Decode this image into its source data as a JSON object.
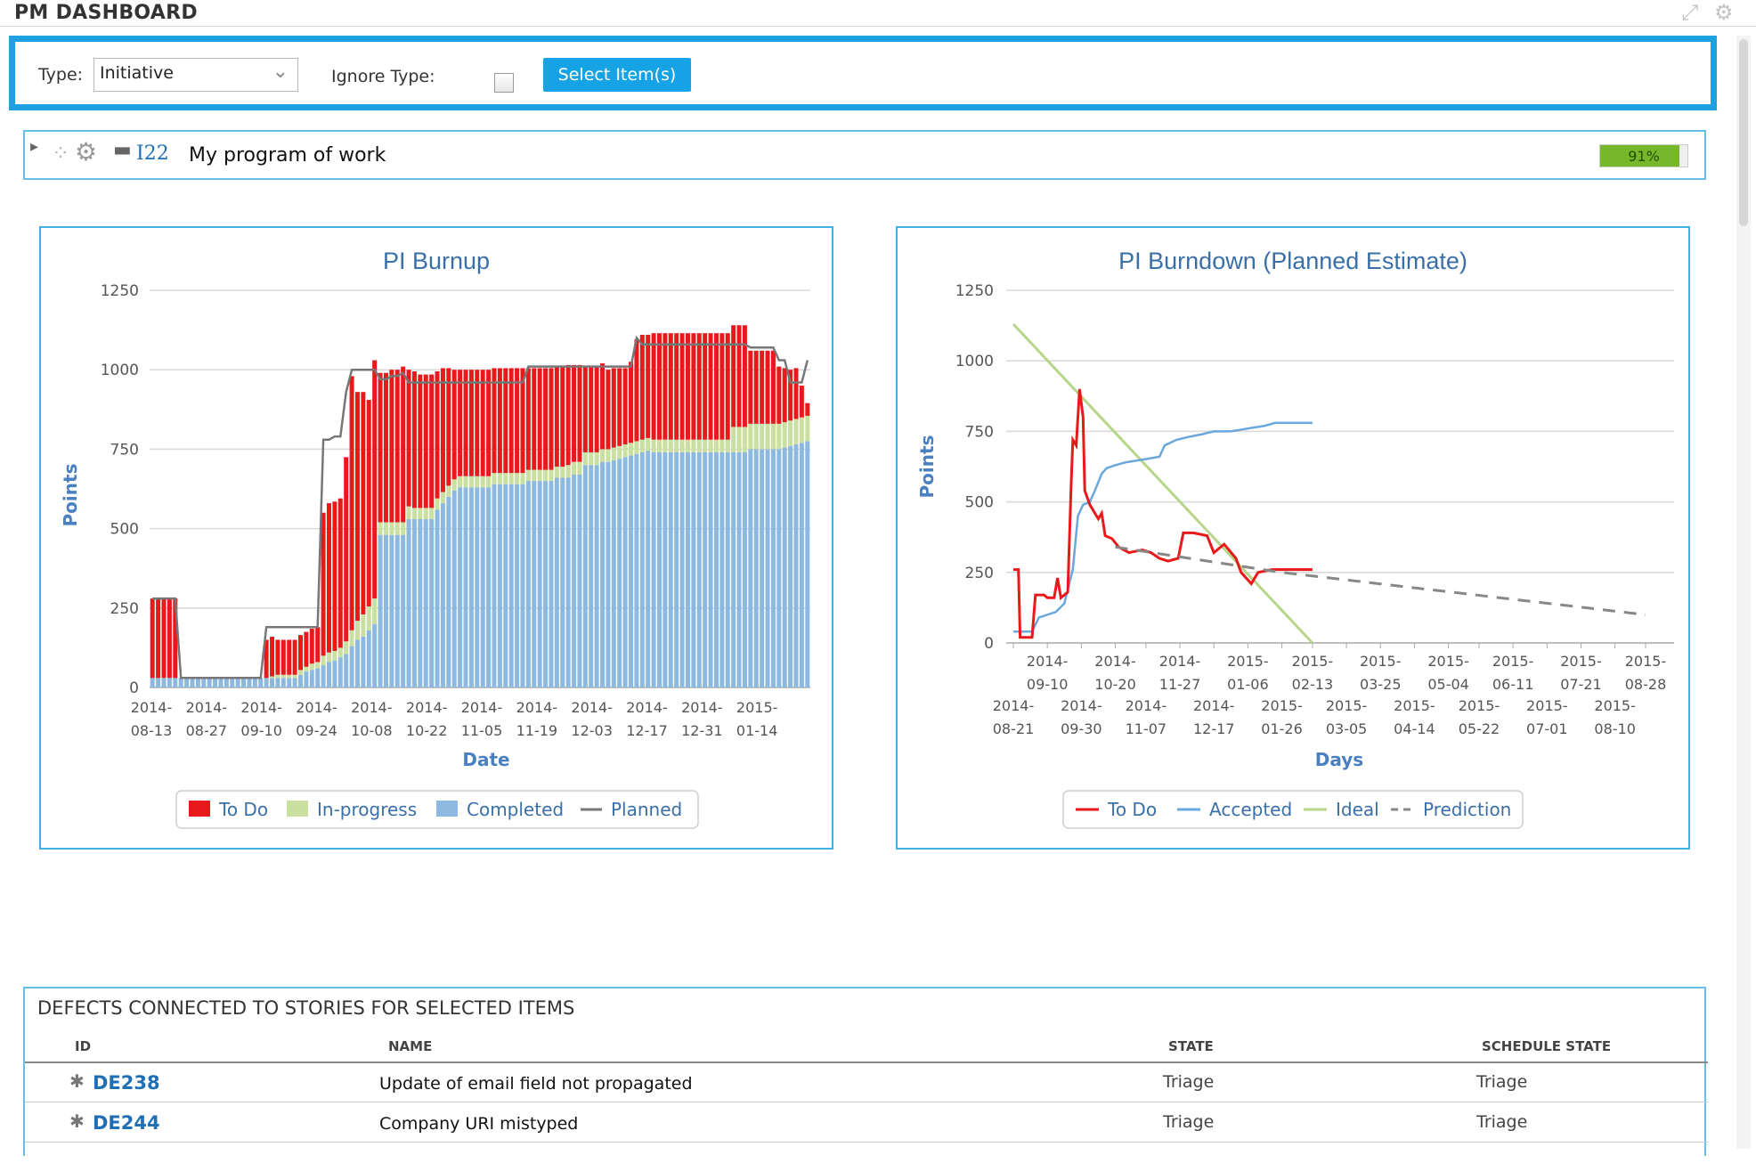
{
  "header": {
    "title": "PM DASHBOARD"
  },
  "settings": {
    "type_label": "Type:",
    "type_value": "Initiative",
    "ignore_type_label": "Ignore Type:",
    "ignore_type_checked": false,
    "select_button": "Select Item(s)"
  },
  "item": {
    "id": "I22",
    "name": "My program of work",
    "progress_label": "91%",
    "progress": 0.91
  },
  "colors": {
    "accent": "#1ea1e1",
    "todo": "#e8191b",
    "in_progress": "#c9e0a0",
    "completed": "#8db8e0",
    "planned": "#777777",
    "accepted": "#6aa7dc",
    "ideal": "#b7d68a",
    "prediction": "#888888",
    "link": "#1f6fb5",
    "progress_fill": "#76b82a"
  },
  "chart_data": [
    {
      "type": "bar",
      "stacked": true,
      "title": "PI Burnup",
      "xlabel": "Date",
      "ylabel": "Points",
      "ylim": [
        0,
        1250
      ],
      "yticks": [
        0,
        250,
        500,
        750,
        1000,
        1250
      ],
      "grid": true,
      "legend_position": "bottom",
      "tick_labels": [
        "2014-08-13",
        "2014-08-27",
        "2014-09-10",
        "2014-09-24",
        "2014-10-08",
        "2014-10-22",
        "2014-11-05",
        "2014-11-19",
        "2014-12-03",
        "2014-12-17",
        "2014-12-31",
        "2015-01-14"
      ],
      "x": [
        "2014-08-13",
        "2014-08-14",
        "2014-08-15",
        "2014-08-18",
        "2014-08-19",
        "2014-08-20",
        "2014-08-21",
        "2014-08-22",
        "2014-08-25",
        "2014-08-26",
        "2014-08-27",
        "2014-08-28",
        "2014-08-29",
        "2014-09-01",
        "2014-09-02",
        "2014-09-03",
        "2014-09-04",
        "2014-09-05",
        "2014-09-08",
        "2014-09-09",
        "2014-09-10",
        "2014-09-11",
        "2014-09-12",
        "2014-09-15",
        "2014-09-16",
        "2014-09-17",
        "2014-09-18",
        "2014-09-19",
        "2014-09-22",
        "2014-09-23",
        "2014-09-24",
        "2014-09-25",
        "2014-09-26",
        "2014-09-29",
        "2014-09-30",
        "2014-10-01",
        "2014-10-02",
        "2014-10-03",
        "2014-10-06",
        "2014-10-07",
        "2014-10-08",
        "2014-10-09",
        "2014-10-10",
        "2014-10-13",
        "2014-10-14",
        "2014-10-15",
        "2014-10-16",
        "2014-10-17",
        "2014-10-20",
        "2014-10-21",
        "2014-10-22",
        "2014-10-23",
        "2014-10-24",
        "2014-10-27",
        "2014-10-28",
        "2014-10-29",
        "2014-10-30",
        "2014-10-31",
        "2014-11-03",
        "2014-11-04",
        "2014-11-05",
        "2014-11-06",
        "2014-11-07",
        "2014-11-10",
        "2014-11-11",
        "2014-11-12",
        "2014-11-13",
        "2014-11-14",
        "2014-11-17",
        "2014-11-18",
        "2014-11-19",
        "2014-11-20",
        "2014-11-21",
        "2014-11-24",
        "2014-11-25",
        "2014-11-26",
        "2014-11-27",
        "2014-11-28",
        "2014-12-01",
        "2014-12-02",
        "2014-12-03",
        "2014-12-04",
        "2014-12-05",
        "2014-12-08",
        "2014-12-09",
        "2014-12-10",
        "2014-12-11",
        "2014-12-12",
        "2014-12-15",
        "2014-12-16",
        "2014-12-17",
        "2014-12-18",
        "2014-12-19",
        "2014-12-22",
        "2014-12-23",
        "2014-12-24",
        "2014-12-25",
        "2014-12-26",
        "2014-12-29",
        "2014-12-30",
        "2014-12-31",
        "2015-01-01",
        "2015-01-02",
        "2015-01-05",
        "2015-01-06",
        "2015-01-07",
        "2015-01-08",
        "2015-01-09",
        "2015-01-12",
        "2015-01-13",
        "2015-01-14",
        "2015-01-15",
        "2015-01-16",
        "2015-01-19",
        "2015-01-20",
        "2015-01-21"
      ],
      "series": [
        {
          "name": "Completed",
          "values": [
            30,
            30,
            30,
            30,
            30,
            30,
            30,
            30,
            30,
            30,
            30,
            30,
            30,
            30,
            30,
            30,
            30,
            30,
            30,
            30,
            30,
            30,
            30,
            30,
            30,
            30,
            40,
            50,
            55,
            60,
            70,
            80,
            85,
            95,
            105,
            130,
            150,
            160,
            180,
            200,
            480,
            480,
            480,
            480,
            480,
            530,
            530,
            530,
            530,
            530,
            560,
            580,
            600,
            620,
            630,
            630,
            630,
            630,
            630,
            630,
            640,
            640,
            640,
            640,
            640,
            640,
            650,
            650,
            650,
            650,
            650,
            660,
            660,
            660,
            670,
            670,
            700,
            700,
            700,
            710,
            710,
            715,
            720,
            725,
            730,
            735,
            740,
            745,
            740,
            740,
            740,
            740,
            740,
            740,
            740,
            740,
            740,
            740,
            740,
            740,
            740,
            740,
            740,
            740,
            740,
            750,
            750,
            750,
            750,
            750,
            750,
            755,
            760,
            765,
            770,
            775
          ]
        },
        {
          "name": "In-progress",
          "values": [
            0,
            0,
            0,
            0,
            0,
            0,
            0,
            0,
            0,
            0,
            0,
            0,
            0,
            0,
            0,
            0,
            0,
            0,
            0,
            0,
            0,
            5,
            10,
            10,
            10,
            10,
            15,
            15,
            20,
            20,
            30,
            30,
            30,
            30,
            40,
            50,
            60,
            70,
            75,
            80,
            40,
            40,
            40,
            40,
            40,
            40,
            35,
            35,
            35,
            35,
            35,
            35,
            35,
            35,
            35,
            35,
            35,
            35,
            35,
            35,
            35,
            35,
            35,
            35,
            35,
            35,
            35,
            35,
            35,
            35,
            35,
            35,
            35,
            40,
            40,
            40,
            40,
            40,
            40,
            40,
            40,
            40,
            40,
            40,
            40,
            40,
            40,
            40,
            40,
            40,
            40,
            40,
            40,
            40,
            40,
            40,
            40,
            40,
            40,
            40,
            40,
            40,
            80,
            80,
            80,
            80,
            80,
            80,
            80,
            80,
            80,
            80,
            80,
            80,
            80,
            80
          ]
        },
        {
          "name": "To Do",
          "values": [
            250,
            250,
            250,
            250,
            250,
            0,
            0,
            0,
            0,
            0,
            0,
            0,
            0,
            0,
            0,
            0,
            0,
            0,
            0,
            0,
            120,
            125,
            110,
            110,
            110,
            110,
            110,
            110,
            110,
            110,
            450,
            470,
            470,
            470,
            580,
            800,
            720,
            700,
            650,
            750,
            470,
            470,
            480,
            480,
            490,
            430,
            430,
            420,
            420,
            420,
            400,
            390,
            370,
            345,
            335,
            335,
            335,
            335,
            335,
            335,
            330,
            330,
            330,
            330,
            330,
            330,
            320,
            320,
            320,
            320,
            320,
            315,
            315,
            315,
            305,
            305,
            270,
            270,
            270,
            270,
            250,
            250,
            245,
            240,
            255,
            320,
            330,
            325,
            335,
            335,
            335,
            335,
            335,
            335,
            335,
            335,
            335,
            335,
            335,
            335,
            335,
            335,
            320,
            320,
            320,
            230,
            230,
            230,
            230,
            230,
            180,
            170,
            160,
            160,
            100,
            40
          ]
        },
        {
          "name": "Planned",
          "type": "line",
          "values": [
            280,
            280,
            280,
            280,
            280,
            30,
            30,
            30,
            30,
            30,
            30,
            30,
            30,
            30,
            30,
            30,
            30,
            30,
            30,
            30,
            190,
            190,
            190,
            190,
            190,
            190,
            190,
            190,
            190,
            190,
            780,
            780,
            790,
            790,
            930,
            1000,
            1000,
            1000,
            1000,
            1000,
            970,
            970,
            980,
            980,
            990,
            960,
            960,
            960,
            960,
            960,
            960,
            960,
            960,
            960,
            960,
            960,
            960,
            960,
            960,
            960,
            960,
            960,
            960,
            960,
            960,
            960,
            1010,
            1010,
            1010,
            1010,
            1010,
            1010,
            1010,
            1010,
            1010,
            1010,
            1010,
            1010,
            1010,
            1010,
            1010,
            1010,
            1010,
            1010,
            1010,
            1100,
            1080,
            1080,
            1080,
            1080,
            1080,
            1080,
            1080,
            1080,
            1080,
            1080,
            1080,
            1080,
            1080,
            1080,
            1080,
            1080,
            1080,
            1080,
            1080,
            1070,
            1070,
            1070,
            1070,
            1070,
            1030,
            1030,
            960,
            960,
            960,
            1030
          ]
        }
      ]
    },
    {
      "type": "line",
      "title": "PI Burndown (Planned Estimate)",
      "xlabel": "Days",
      "ylabel": "Points",
      "ylim": [
        0,
        1250
      ],
      "yticks": [
        0,
        250,
        500,
        750,
        1000,
        1250
      ],
      "grid": true,
      "legend_position": "bottom",
      "tick_labels": [
        "2014-08-21",
        "2014-09-10",
        "2014-09-30",
        "2014-10-20",
        "2014-11-07",
        "2014-11-27",
        "2014-12-17",
        "2015-01-06",
        "2015-01-26",
        "2015-02-13",
        "2015-03-05",
        "2015-03-25",
        "2015-04-14",
        "2015-05-04",
        "2015-05-22",
        "2015-06-11",
        "2015-07-01",
        "2015-07-21",
        "2015-08-10",
        "2015-08-28"
      ],
      "series": [
        {
          "name": "To Do",
          "points": [
            [
              "2014-08-21",
              260
            ],
            [
              "2014-08-24",
              260
            ],
            [
              "2014-08-25",
              20
            ],
            [
              "2014-09-01",
              20
            ],
            [
              "2014-09-03",
              170
            ],
            [
              "2014-09-08",
              170
            ],
            [
              "2014-09-10",
              160
            ],
            [
              "2014-09-14",
              160
            ],
            [
              "2014-09-16",
              230
            ],
            [
              "2014-09-18",
              160
            ],
            [
              "2014-09-22",
              180
            ],
            [
              "2014-09-24",
              560
            ],
            [
              "2014-09-25",
              720
            ],
            [
              "2014-09-27",
              700
            ],
            [
              "2014-09-29",
              900
            ],
            [
              "2014-10-01",
              800
            ],
            [
              "2014-10-02",
              540
            ],
            [
              "2014-10-05",
              490
            ],
            [
              "2014-10-08",
              460
            ],
            [
              "2014-10-10",
              440
            ],
            [
              "2014-10-12",
              460
            ],
            [
              "2014-10-14",
              380
            ],
            [
              "2014-10-18",
              370
            ],
            [
              "2014-10-22",
              340
            ],
            [
              "2014-10-28",
              320
            ],
            [
              "2014-11-05",
              330
            ],
            [
              "2014-11-10",
              320
            ],
            [
              "2014-11-15",
              300
            ],
            [
              "2014-11-20",
              290
            ],
            [
              "2014-11-26",
              300
            ],
            [
              "2014-11-29",
              390
            ],
            [
              "2014-12-05",
              390
            ],
            [
              "2014-12-13",
              380
            ],
            [
              "2014-12-17",
              320
            ],
            [
              "2014-12-23",
              350
            ],
            [
              "2014-12-30",
              300
            ],
            [
              "2015-01-02",
              250
            ],
            [
              "2015-01-08",
              210
            ],
            [
              "2015-01-12",
              250
            ],
            [
              "2015-01-20",
              260
            ],
            [
              "2015-01-26",
              260
            ],
            [
              "2015-02-13",
              260
            ]
          ]
        },
        {
          "name": "Accepted",
          "points": [
            [
              "2014-08-21",
              40
            ],
            [
              "2014-09-01",
              40
            ],
            [
              "2014-09-05",
              90
            ],
            [
              "2014-09-15",
              110
            ],
            [
              "2014-09-20",
              140
            ],
            [
              "2014-09-25",
              260
            ],
            [
              "2014-09-28",
              450
            ],
            [
              "2014-10-01",
              490
            ],
            [
              "2014-10-05",
              500
            ],
            [
              "2014-10-08",
              540
            ],
            [
              "2014-10-12",
              600
            ],
            [
              "2014-10-15",
              620
            ],
            [
              "2014-10-20",
              630
            ],
            [
              "2014-10-26",
              640
            ],
            [
              "2014-11-05",
              650
            ],
            [
              "2014-11-15",
              660
            ],
            [
              "2014-11-18",
              700
            ],
            [
              "2014-11-25",
              720
            ],
            [
              "2014-12-02",
              730
            ],
            [
              "2014-12-10",
              740
            ],
            [
              "2014-12-17",
              750
            ],
            [
              "2014-12-27",
              750
            ],
            [
              "2015-01-06",
              760
            ],
            [
              "2015-01-16",
              770
            ],
            [
              "2015-01-22",
              780
            ],
            [
              "2015-02-13",
              780
            ]
          ]
        },
        {
          "name": "Ideal",
          "points": [
            [
              "2014-08-21",
              1130
            ],
            [
              "2015-02-13",
              0
            ]
          ]
        },
        {
          "name": "Prediction",
          "style": "dashed",
          "points": [
            [
              "2014-10-20",
              340
            ],
            [
              "2015-01-26",
              250
            ],
            [
              "2015-08-28",
              100
            ]
          ]
        }
      ]
    }
  ],
  "defects": {
    "title": "DEFECTS CONNECTED TO STORIES FOR SELECTED ITEMS",
    "columns": [
      "ID",
      "NAME",
      "STATE",
      "SCHEDULE STATE"
    ],
    "rows": [
      {
        "id": "DE238",
        "name": "Update of email field not propagated",
        "state": "Triage",
        "schedule_state": "Triage"
      },
      {
        "id": "DE244",
        "name": "Company URI mistyped",
        "state": "Triage",
        "schedule_state": "Triage"
      }
    ]
  }
}
